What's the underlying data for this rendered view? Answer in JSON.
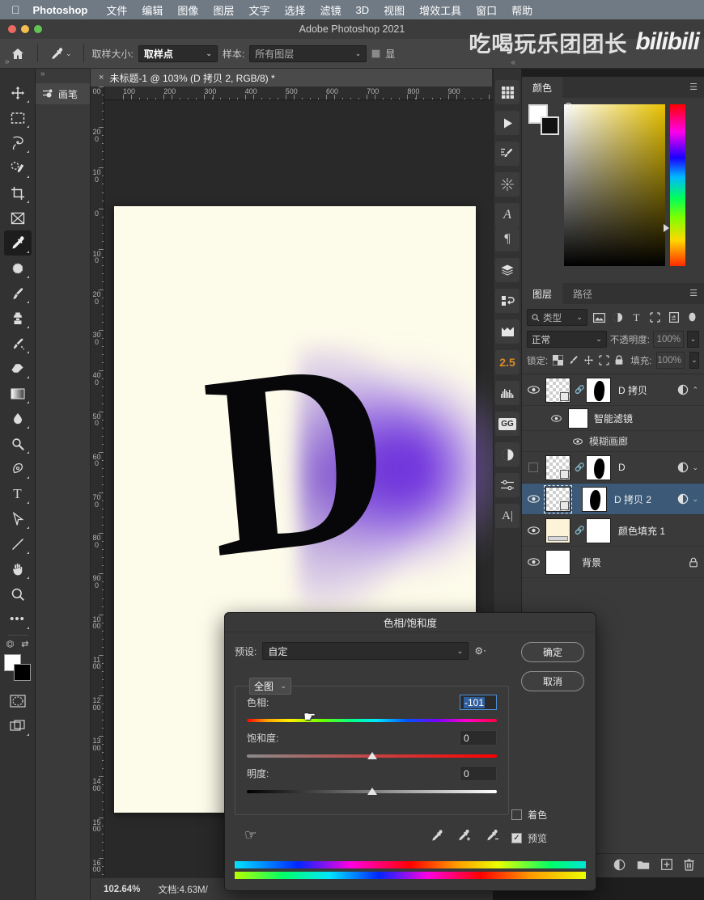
{
  "macmenu": {
    "apple": "apple-logo",
    "app": "Photoshop",
    "items": [
      "文件",
      "编辑",
      "图像",
      "图层",
      "文字",
      "选择",
      "滤镜",
      "3D",
      "视图",
      "增效工具",
      "窗口",
      "帮助"
    ]
  },
  "titlebar": {
    "title": "Adobe Photoshop 2021"
  },
  "optionsbar": {
    "home_icon": "home-icon",
    "tool_icon": "eyedropper-icon",
    "sample_size_label": "取样大小:",
    "sample_size_value": "取样点",
    "sample_label": "样本:",
    "sample_value": "所有图层",
    "show_label": "显"
  },
  "watermark": {
    "text": "吃喝玩乐团团长",
    "logo": "bilibili"
  },
  "toolbar": {
    "collapse": "»",
    "tools": [
      {
        "name": "move-tool",
        "glyph": "✥"
      },
      {
        "name": "marquee-tool",
        "glyph": "▭"
      },
      {
        "name": "lasso-tool",
        "glyph": "➹"
      },
      {
        "name": "quick-selection-tool",
        "glyph": "✎"
      },
      {
        "name": "crop-tool",
        "glyph": "⌗"
      },
      {
        "name": "frame-tool",
        "glyph": "⊠"
      },
      {
        "name": "eyedropper-tool",
        "glyph": "⚲"
      },
      {
        "name": "spot-healing-tool",
        "glyph": "✺"
      },
      {
        "name": "brush-tool",
        "glyph": "🖌"
      },
      {
        "name": "clone-stamp-tool",
        "glyph": "⌶"
      },
      {
        "name": "history-brush-tool",
        "glyph": "✒"
      },
      {
        "name": "eraser-tool",
        "glyph": "⌫"
      },
      {
        "name": "gradient-tool",
        "glyph": "▤"
      },
      {
        "name": "blur-tool",
        "glyph": "◗"
      },
      {
        "name": "dodge-tool",
        "glyph": "⚪"
      },
      {
        "name": "pen-tool",
        "glyph": "✑"
      },
      {
        "name": "type-tool",
        "glyph": "T"
      },
      {
        "name": "path-selection-tool",
        "glyph": "➤"
      },
      {
        "name": "line-tool",
        "glyph": "／"
      },
      {
        "name": "hand-tool",
        "glyph": "✋"
      },
      {
        "name": "zoom-tool",
        "glyph": "◌"
      },
      {
        "name": "more-tools",
        "glyph": "•••"
      }
    ],
    "active_index": 6,
    "swatch_fg": "#ffffff",
    "swatch_bg": "#000000",
    "quickmask_icon": "quick-mask-icon",
    "screenmode_icon": "screen-mode-icon"
  },
  "leftpanel": {
    "collapse": "»",
    "tab_label": "画笔",
    "tab_icon": "brush-preset-icon"
  },
  "doctab": {
    "close": "×",
    "title": "未标题-1 @ 103% (D 拷贝 2, RGB/8) *"
  },
  "rulers": {
    "h_labels": [
      "100",
      "200",
      "300",
      "400",
      "500",
      "600",
      "700",
      "800",
      "900"
    ],
    "v_labels": [
      "00",
      "200",
      "100",
      "0",
      "100",
      "200",
      "300",
      "400",
      "500",
      "600",
      "700",
      "800",
      "900",
      "1000",
      "1100",
      "1200",
      "1300",
      "1400",
      "1500",
      "1600"
    ]
  },
  "rightdock": {
    "collapse": "«",
    "items": [
      {
        "name": "libraries-icon",
        "glyph": "▦"
      },
      {
        "name": "actions-icon",
        "glyph": "▶"
      },
      {
        "name": "brush-settings-icon",
        "glyph": "✎"
      },
      {
        "name": "styles-icon",
        "glyph": "✺"
      },
      {
        "name": "character-icon",
        "glyph": "A"
      },
      {
        "name": "paragraph-icon",
        "glyph": "¶"
      },
      {
        "name": "layer-comps-icon",
        "glyph": "◤"
      },
      {
        "name": "history-icon",
        "glyph": "↺"
      },
      {
        "name": "notes-icon",
        "glyph": "▣"
      },
      {
        "name": "version-badge",
        "glyph": "2.5"
      },
      {
        "name": "histogram-icon",
        "glyph": "▁▄█▆"
      },
      {
        "name": "gg-plugin-icon",
        "glyph": "GG"
      },
      {
        "name": "adjustments-icon",
        "glyph": "◐"
      },
      {
        "name": "properties-icon",
        "glyph": "⚌"
      },
      {
        "name": "glyphs-icon",
        "glyph": "A|"
      }
    ]
  },
  "colorpanel": {
    "tab": "颜色",
    "menu": "panel-menu-icon",
    "fg": "#ffffff",
    "bg": "#111111"
  },
  "layerspanel": {
    "tabs": [
      {
        "label": "图层",
        "active": true
      },
      {
        "label": "路径",
        "active": false
      }
    ],
    "menu": "panel-menu-icon",
    "filter": {
      "search_icon": "search-icon",
      "value": "类型",
      "caret": "⌄",
      "icons": [
        "image-filter-icon",
        "adjustment-filter-icon",
        "type-filter-icon",
        "shape-filter-icon",
        "smart-object-filter-icon",
        "toggle-filter-icon"
      ]
    },
    "blend_mode": "正常",
    "opacity_label": "不透明度:",
    "opacity_value": "100%",
    "lock_label": "锁定:",
    "lock_icons": [
      "lock-transparent-icon",
      "lock-image-icon",
      "lock-position-icon",
      "lock-artboard-icon",
      "lock-all-icon"
    ],
    "fill_label": "填充:",
    "fill_value": "100%",
    "layers": [
      {
        "name": "D 拷贝",
        "visible": true,
        "selected": false,
        "kind": "smart",
        "has_mask": true,
        "fx": true,
        "caret": "⌃"
      },
      {
        "name": "智能滤镜",
        "visible": true,
        "selected": false,
        "kind": "subfilter"
      },
      {
        "name": "模糊画廊",
        "visible": true,
        "selected": false,
        "kind": "subfilter2"
      },
      {
        "name": "D",
        "visible": false,
        "selected": false,
        "kind": "smart",
        "has_mask": true,
        "fx": true,
        "caret": "⌄"
      },
      {
        "name": "D 拷贝 2",
        "visible": true,
        "selected": true,
        "kind": "smart",
        "has_mask": true,
        "fx": true,
        "caret": "⌄"
      },
      {
        "name": "颜色填充 1",
        "visible": true,
        "selected": false,
        "kind": "fill",
        "has_mask": true,
        "fill_color": "#fdf3d8"
      },
      {
        "name": "背景",
        "visible": true,
        "selected": false,
        "kind": "background",
        "locked": true
      }
    ],
    "bottom_icons": [
      "link-layers-icon",
      "layer-style-icon",
      "layer-mask-icon",
      "adjustment-layer-icon",
      "new-group-icon",
      "new-layer-icon",
      "delete-layer-icon"
    ]
  },
  "statusbar": {
    "zoom": "102.64%",
    "doc": "文档:4.63M/"
  },
  "dialog": {
    "title": "色相/饱和度",
    "preset_label": "预设:",
    "preset_value": "自定",
    "gear_icon": "gear-icon",
    "ok": "确定",
    "cancel": "取消",
    "range_value": "全图",
    "sliders": [
      {
        "name": "hue",
        "label": "色相:",
        "value": "-101",
        "pos": 18,
        "focused": true
      },
      {
        "name": "saturation",
        "label": "饱和度:",
        "value": "0",
        "pos": 50,
        "focused": false
      },
      {
        "name": "lightness",
        "label": "明度:",
        "value": "0",
        "pos": 50,
        "focused": false
      }
    ],
    "hand_icon": "hand-icon",
    "droppers": [
      "eyedropper-icon",
      "eyedropper-add-icon",
      "eyedropper-subtract-icon"
    ],
    "colorize_label": "着色",
    "colorize_checked": false,
    "preview_label": "预览",
    "preview_checked": true
  },
  "canvas": {
    "artwork": "letter-D-with-purple-blur-glow",
    "letter": "D"
  }
}
